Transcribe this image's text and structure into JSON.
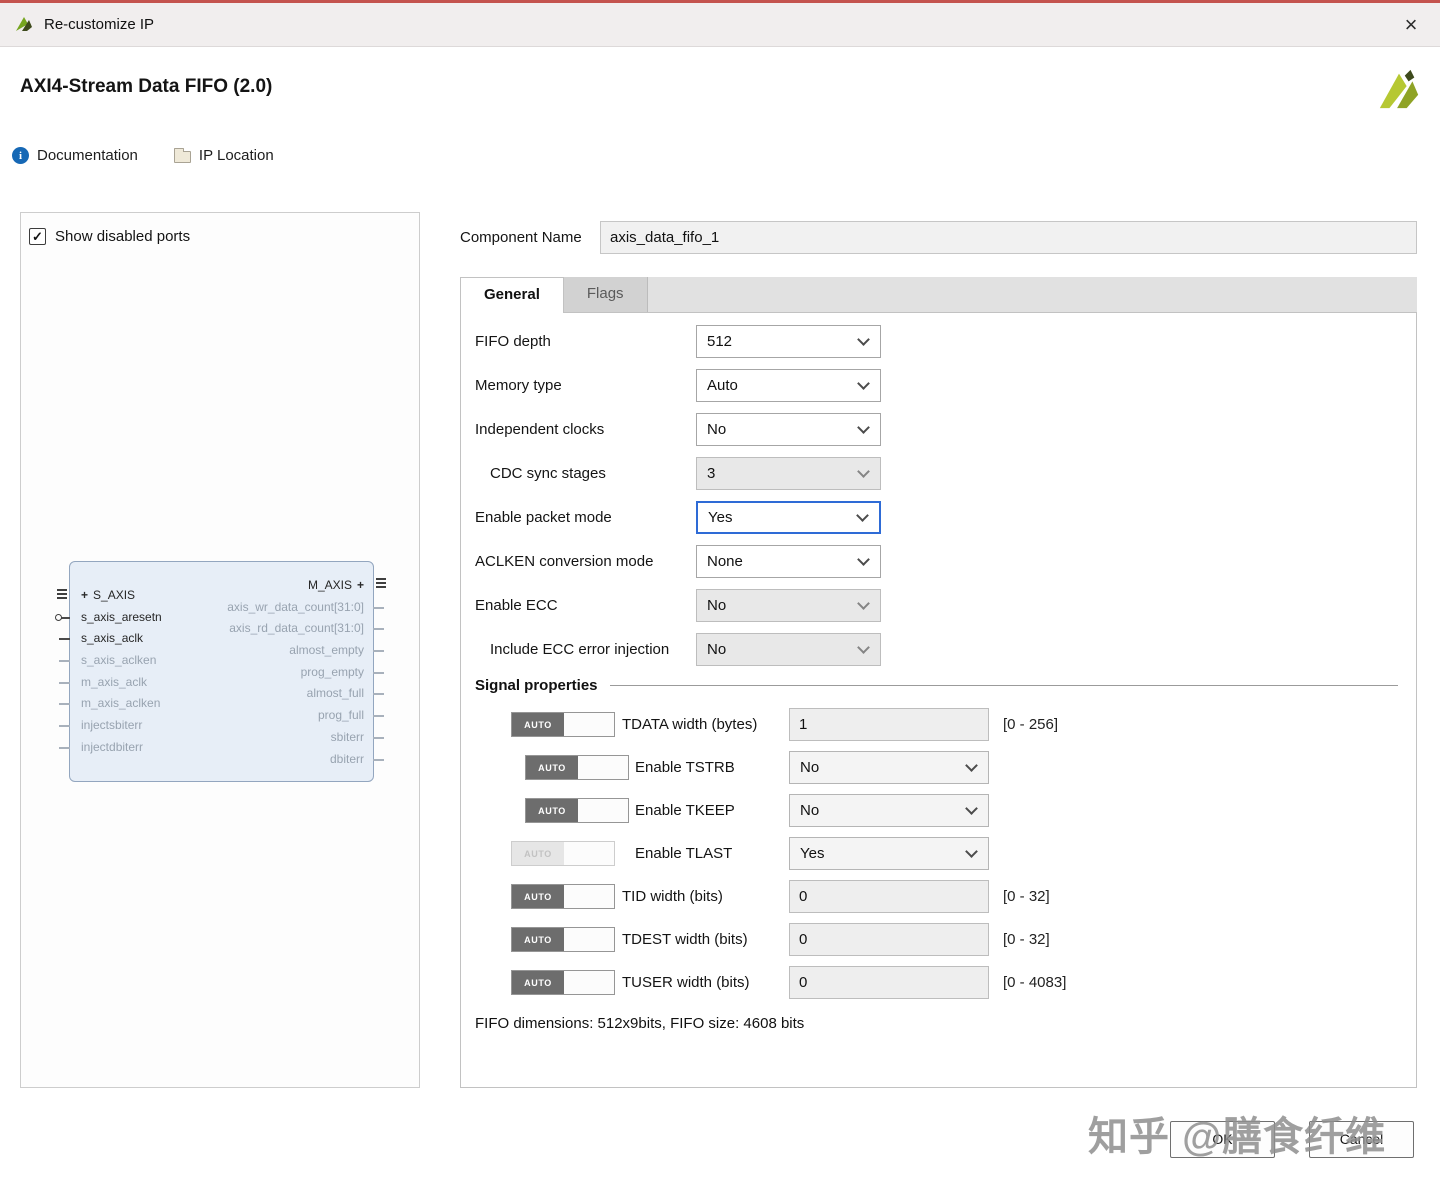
{
  "window": {
    "title": "Re-customize IP"
  },
  "icons": {
    "close": "×",
    "check": "✓",
    "info": "i",
    "plus": "+"
  },
  "header": {
    "title": "AXI4-Stream Data FIFO (2.0)"
  },
  "toolbar": {
    "documentation": "Documentation",
    "ip_location": "IP Location"
  },
  "left_panel": {
    "show_disabled_ports": "Show disabled ports"
  },
  "block": {
    "left_ports": [
      {
        "label": "S_AXIS"
      },
      {
        "label": "s_axis_aresetn"
      },
      {
        "label": "s_axis_aclk"
      },
      {
        "label": "s_axis_aclken"
      },
      {
        "label": "m_axis_aclk"
      },
      {
        "label": "m_axis_aclken"
      },
      {
        "label": "injectsbiterr"
      },
      {
        "label": "injectdbiterr"
      }
    ],
    "right_ports": [
      {
        "label": "M_AXIS"
      },
      {
        "label": "axis_wr_data_count[31:0]"
      },
      {
        "label": "axis_rd_data_count[31:0]"
      },
      {
        "label": "almost_empty"
      },
      {
        "label": "prog_empty"
      },
      {
        "label": "almost_full"
      },
      {
        "label": "prog_full"
      },
      {
        "label": "sbiterr"
      },
      {
        "label": "dbiterr"
      }
    ]
  },
  "component": {
    "label": "Component Name",
    "value": "axis_data_fifo_1"
  },
  "tabs": {
    "general": "General",
    "flags": "Flags"
  },
  "general": {
    "fields": [
      {
        "label": "FIFO depth",
        "value": "512"
      },
      {
        "label": "Memory type",
        "value": "Auto"
      },
      {
        "label": "Independent clocks",
        "value": "No"
      },
      {
        "label": "CDC sync stages",
        "value": "3"
      },
      {
        "label": "Enable packet mode",
        "value": "Yes"
      },
      {
        "label": "ACLKEN conversion mode",
        "value": "None"
      },
      {
        "label": "Enable ECC",
        "value": "No"
      },
      {
        "label": "Include ECC error injection",
        "value": "No"
      }
    ]
  },
  "signal": {
    "title": "Signal properties",
    "auto_label": "AUTO",
    "rows": [
      {
        "label": "TDATA width (bytes)",
        "value": "1",
        "range": "[0 - 256]"
      },
      {
        "label": "Enable TSTRB",
        "value": "No",
        "range": ""
      },
      {
        "label": "Enable TKEEP",
        "value": "No",
        "range": ""
      },
      {
        "label": "Enable TLAST",
        "value": "Yes",
        "range": ""
      },
      {
        "label": "TID width (bits)",
        "value": "0",
        "range": "[0 - 32]"
      },
      {
        "label": "TDEST width (bits)",
        "value": "0",
        "range": "[0 - 32]"
      },
      {
        "label": "TUSER width (bits)",
        "value": "0",
        "range": "[0 - 4083]"
      }
    ],
    "footer": "FIFO dimensions: 512x9bits, FIFO size: 4608 bits"
  },
  "buttons": {
    "ok": "OK",
    "cancel": "Cancel"
  },
  "watermark": {
    "text": "知乎 @膳食纤维"
  }
}
